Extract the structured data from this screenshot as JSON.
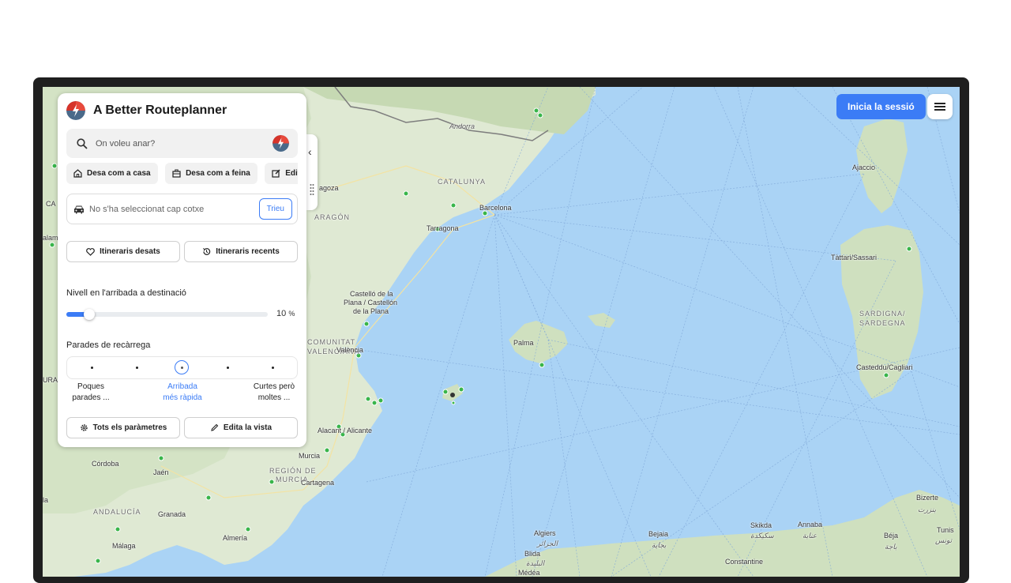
{
  "app": {
    "title": "A Better Routeplanner",
    "login_label": "Inicia la sessió",
    "menu_icon": "hamburger-icon"
  },
  "search": {
    "placeholder": "On voleu anar?",
    "icon": "search-icon"
  },
  "quick_actions": [
    {
      "label": "Desa com a casa",
      "icon": "home-icon"
    },
    {
      "label": "Desa com a feina",
      "icon": "briefcase-icon"
    },
    {
      "label": "Edita",
      "icon": "edit-icon"
    }
  ],
  "vehicle": {
    "text": "No s'ha seleccionat cap cotxe",
    "choose_label": "Trieu",
    "icon": "car-icon"
  },
  "routes": {
    "saved_label": "Itineraris desats",
    "recent_label": "Itineraris recents"
  },
  "arrival": {
    "label": "Nivell en l'arribada a destinació",
    "value": 10,
    "value_text": "10",
    "unit": "%",
    "max": 100
  },
  "charging": {
    "label": "Parades de recàrrega",
    "selected_index": 2,
    "options": [
      {
        "line1": "Poques",
        "line2": "parades ..."
      },
      {
        "line1": "Arribada",
        "line2": "més ràpida"
      },
      {
        "line1": "Curtes però",
        "line2": "moltes ..."
      }
    ]
  },
  "footer": {
    "settings_label": "Tots els paràmetres",
    "edit_view_label": "Edita la vista"
  },
  "map": {
    "labels": {
      "andorra": "Andorra",
      "catalunya": "CATALUNYA",
      "barcelona": "Barcelona",
      "tarragona": "Tarragona",
      "saragossa": "agoza",
      "arago": "ARAGÓN",
      "castello1": "Castelló de la",
      "castello2": "Plana / Castellón",
      "castello3": "de la Plana",
      "comunitat1": "COMUNITAT",
      "comunitat2": "VALENCIANA",
      "valencia": "València",
      "palma": "Palma",
      "alacant": "Alacant / Alicante",
      "murcia": "Murcia",
      "region1": "REGIÓN DE",
      "region2": "MURCIA",
      "cartagena": "Cartagena",
      "cordoba": "Córdoba",
      "jaen": "Jaén",
      "andalucia": "ANDALUCÍA",
      "granada": "Granada",
      "almeria": "Almería",
      "malaga": "Málaga",
      "ajaccio": "Ajaccio",
      "tattari": "Tàttari/Sassari",
      "sardigna1": "SARDIGNA/",
      "sardigna2": "SARDEGNA",
      "casteddu": "Casteddu/Cagliari",
      "algiers": "Algiers",
      "algiers_ar": "الجزائر",
      "blida": "Blida",
      "blida_ar": "البليدة",
      "bejaia": "Bejaia",
      "bejaia_ar": "بجاية",
      "skikda": "Skikda",
      "skikda_ar": "سكيكدة",
      "annaba": "Annaba",
      "annaba_ar": "عنابة",
      "constantine": "Constantine",
      "bizerte": "Bizerte",
      "bizerte_ar": "بنزرت",
      "tunis": "Tunis",
      "tunis_ar": "تونس",
      "beja": "Béja",
      "beja_ar": "باجة",
      "medea": "Médéa",
      "ura": "URA",
      "ca": "CA",
      "alam": "alam",
      "la": "la"
    }
  }
}
